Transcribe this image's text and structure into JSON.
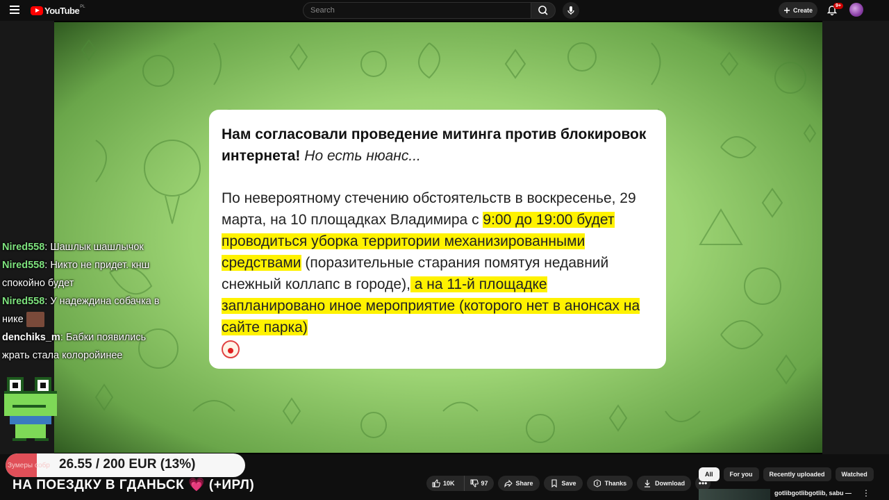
{
  "header": {
    "logo_text": "YouTube",
    "country_code": "PL",
    "search_placeholder": "Search",
    "create_label": "Create",
    "notifications_badge": "9+"
  },
  "post": {
    "title_bold": "Нам согласовали проведение митинга против блокировок интернета!",
    "title_italic": "Но есть нюанс...",
    "body_plain_1": "По невероятному стечению обстоятельств в воскресенье, 29 марта, на 10 площадках Владимира с ",
    "body_highlight_1": "9:00 до 19:00 будет проводиться уборка территории механизированными средствами",
    "body_plain_2": " (поразительные старания помятуя недавний снежный коллапс в городе),",
    "body_highlight_2": " а на 11-й площадке запланировано иное мероприятие (которого нет в анонсах на сайте парка)"
  },
  "chat": {
    "messages": [
      {
        "nick": "Nired558",
        "text": "Шашлык шашлычок"
      },
      {
        "nick": "Nired558",
        "text": "Никто не придет. кнш спокойно будет"
      },
      {
        "nick": "Nired558",
        "text": "У надеждина собачка в нике"
      },
      {
        "nick": "denchiks_m",
        "text": "Бабки появились жрать стала колоройинее"
      }
    ]
  },
  "donation": {
    "label": "26.55 / 200 EUR (13%)",
    "progress_percent": 13,
    "ghost_text": "Зумеры собр",
    "fill_color": "#e04f58"
  },
  "tagline": "НА ПОЕЗДКУ В ГДАНЬСК 💗 (+ИРЛ)",
  "actions": {
    "likes": "10K",
    "dislikes": "97",
    "share": "Share",
    "save": "Save",
    "thanks": "Thanks",
    "download": "Download"
  },
  "chips": [
    "All",
    "For you",
    "Recently uploaded",
    "Watched"
  ],
  "recommendation": {
    "title": "gotlibgotlibgotlib, sabu —"
  }
}
